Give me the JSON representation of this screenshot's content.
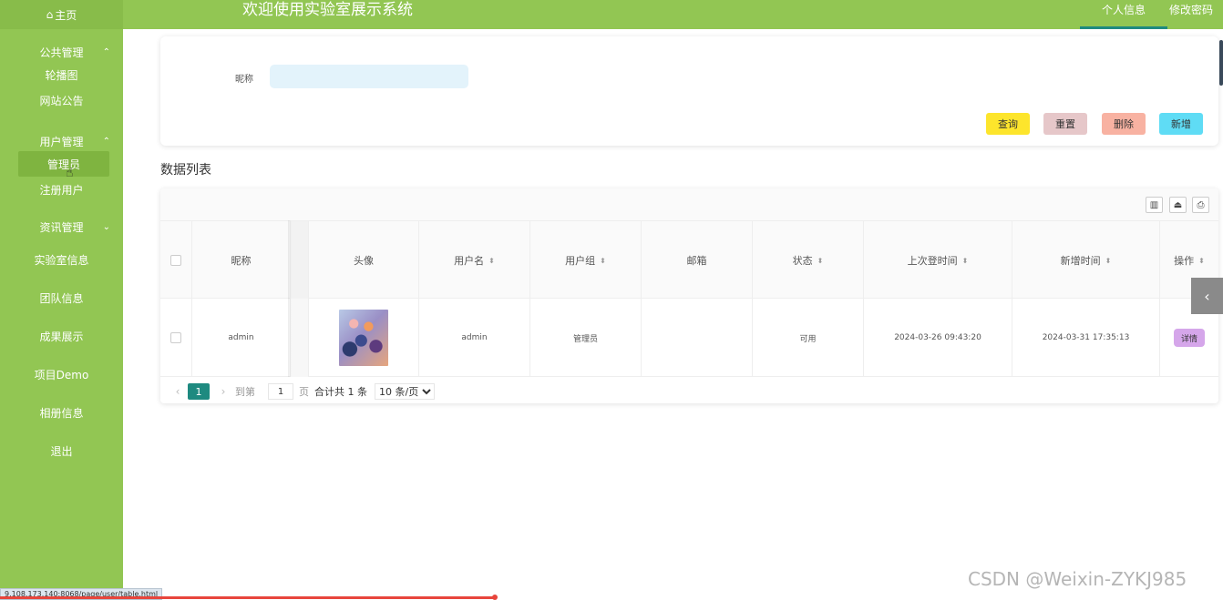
{
  "sidebar": {
    "home": "主页",
    "groups": [
      {
        "title": "公共管理",
        "items": [
          "轮播图",
          "网站公告"
        ]
      },
      {
        "title": "用户管理",
        "items": [
          "管理员",
          "注册用户"
        ]
      },
      {
        "title": "资讯管理"
      }
    ],
    "items": [
      "实验室信息",
      "团队信息",
      "成果展示",
      "项目Demo",
      "相册信息",
      "退出"
    ]
  },
  "header": {
    "title": "欢迎使用实验室展示系统",
    "profile": "个人信息",
    "change_password": "修改密码"
  },
  "search": {
    "nickname_label": "昵称",
    "nickname_value": "",
    "buttons": {
      "search": "查询",
      "reset": "重置",
      "delete": "删除",
      "add": "新增"
    }
  },
  "list_title": "数据列表",
  "table": {
    "columns": [
      "昵称",
      "头像",
      "用户名",
      "用户组",
      "邮箱",
      "状态",
      "上次登时间",
      "新增时间",
      "操作"
    ],
    "rows": [
      {
        "nickname": "admin",
        "username": "admin",
        "group": "管理员",
        "email": "",
        "status": "可用",
        "last_login": "2024-03-26 09:43:20",
        "created": "2024-03-31 17:35:13",
        "action": "详情"
      }
    ]
  },
  "pagination": {
    "current": "1",
    "goto_label": "到第",
    "goto_value": "1",
    "page_suffix": "页",
    "total": "合计共 1 条",
    "page_size": "10 条/页"
  },
  "status_url": "9.108.173.140:8068/page/user/table.html",
  "watermark": "CSDN @Weixin-ZYKJ985",
  "colors": {
    "sidebar": "#92c653",
    "accent": "#1e8a80",
    "search": "#fde52c",
    "reset": "#e6c7c9",
    "delete": "#f8b2a2",
    "add": "#5fdcf5",
    "detail": "#d5a6ea"
  }
}
